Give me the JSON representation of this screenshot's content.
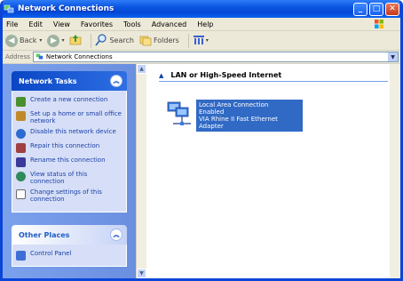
{
  "window": {
    "title": "Network Connections"
  },
  "menu": [
    "File",
    "Edit",
    "View",
    "Favorites",
    "Tools",
    "Advanced",
    "Help"
  ],
  "toolbar": {
    "back": "Back",
    "search": "Search",
    "folders": "Folders"
  },
  "address": {
    "label": "Address",
    "value": "Network Connections"
  },
  "tasks_panel": {
    "title": "Network Tasks",
    "items": [
      {
        "label": "Create a new connection",
        "icon": "new-connection-icon",
        "color": "#4a8f2e"
      },
      {
        "label": "Set up a home or small office network",
        "icon": "home-network-icon",
        "color": "#c08a2a"
      },
      {
        "label": "Disable this network device",
        "icon": "disable-device-icon",
        "color": "#2e6bd1"
      },
      {
        "label": "Repair this connection",
        "icon": "repair-icon",
        "color": "#a04040"
      },
      {
        "label": "Rename this connection",
        "icon": "rename-icon",
        "color": "#3a3a9a"
      },
      {
        "label": "View status of this connection",
        "icon": "status-icon",
        "color": "#2f8a5c"
      },
      {
        "label": "Change settings of this connection",
        "icon": "settings-icon",
        "color": "#6a6a6a"
      }
    ]
  },
  "other_panel": {
    "title": "Other Places",
    "items": [
      {
        "label": "Control Panel",
        "icon": "control-panel-icon"
      }
    ]
  },
  "group": {
    "title": "LAN or High-Speed Internet"
  },
  "connection": {
    "line1": "Local Area Connection",
    "line2": "Enabled",
    "line3": "VIA Rhine II Fast Ethernet Adapter"
  }
}
